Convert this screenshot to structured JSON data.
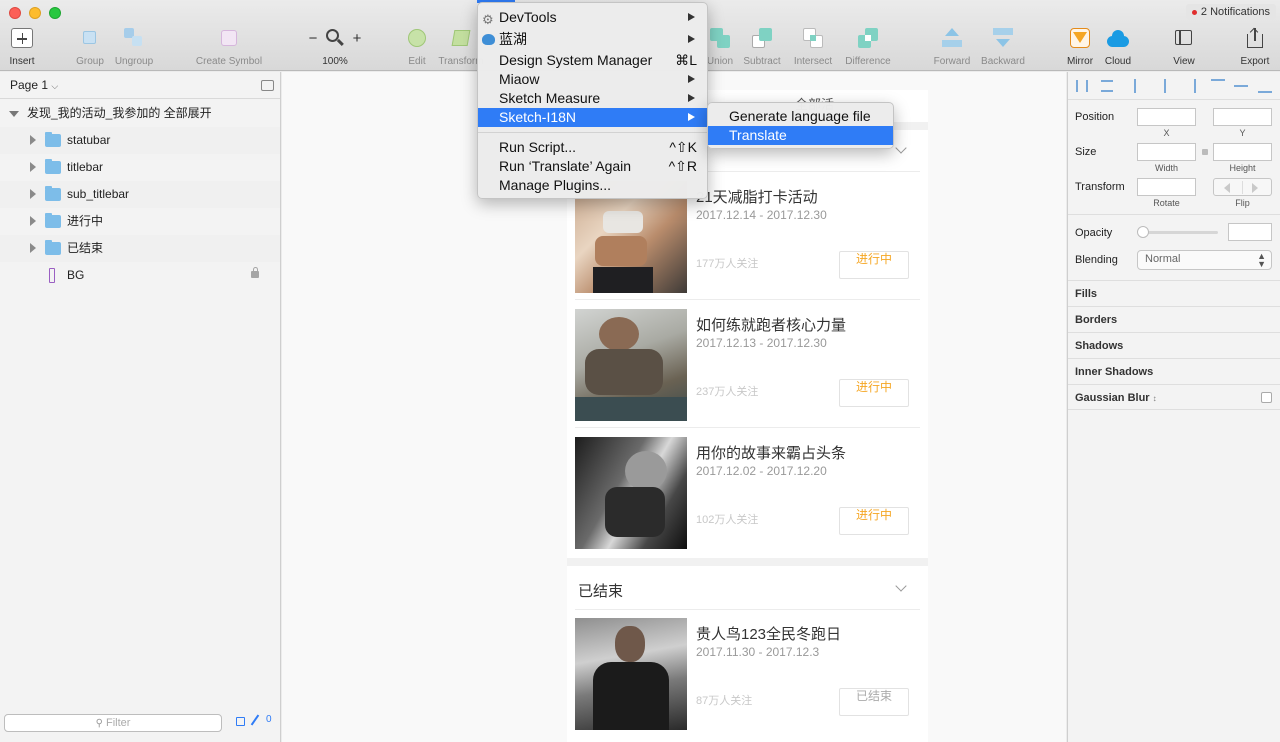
{
  "notifications": "2 Notifications",
  "toolbar": {
    "insert": "Insert",
    "group": "Group",
    "ungroup": "Ungroup",
    "create_symbol": "Create Symbol",
    "zoom_minus": "−",
    "zoom_plus": "+",
    "zoom": "100%",
    "edit": "Edit",
    "transform": "Transform",
    "union": "Union",
    "subtract": "Subtract",
    "intersect": "Intersect",
    "difference": "Difference",
    "forward": "Forward",
    "backward": "Backward",
    "mirror": "Mirror",
    "cloud": "Cloud",
    "view": "View",
    "export": "Export"
  },
  "layers": {
    "page": "Page 1",
    "artboard": "发现_我的活动_我参加的 全部展开",
    "items": [
      {
        "label": "statubar",
        "type": "folder"
      },
      {
        "label": "titlebar",
        "type": "folder"
      },
      {
        "label": "sub_titlebar",
        "type": "folder"
      },
      {
        "label": "进行中",
        "type": "folder"
      },
      {
        "label": "已结束",
        "type": "folder"
      },
      {
        "label": "BG",
        "type": "rect"
      }
    ],
    "filter_placeholder": "Filter",
    "filter_count": "0"
  },
  "plugins_menu": {
    "items": [
      {
        "label": "DevTools",
        "submenu": true
      },
      {
        "label": "蓝湖",
        "submenu": true
      },
      {
        "label": "Design System Manager",
        "shortcut": "⌘L"
      },
      {
        "label": "Miaow",
        "submenu": true
      },
      {
        "label": "Sketch Measure",
        "submenu": true
      },
      {
        "label": "Sketch-I18N",
        "submenu": true,
        "highlighted": true
      }
    ],
    "run_script": "Run Script...",
    "run_script_sc": "^⇧K",
    "run_again": "Run ‘Translate’ Again",
    "run_again_sc": "^⇧R",
    "manage": "Manage Plugins..."
  },
  "submenu": {
    "generate": "Generate language file",
    "translate": "Translate"
  },
  "artboard": {
    "top_tab_partial": "全部活",
    "ongoing_cards": [
      {
        "title": "21天减脂打卡活动",
        "date": "2017.12.14 - 2017.12.30",
        "followers": "177万人关注",
        "status": "进行中"
      },
      {
        "title": "如何练就跑者核心力量",
        "date": "2017.12.13 - 2017.12.30",
        "followers": "237万人关注",
        "status": "进行中"
      },
      {
        "title": "用你的故事来霸占头条",
        "date": "2017.12.02 - 2017.12.20",
        "followers": "102万人关注",
        "status": "进行中"
      }
    ],
    "ended_section": "已结束",
    "ended_cards": [
      {
        "title": "贵人鸟123全民冬跑日",
        "date": "2017.11.30 - 2017.12.3",
        "followers": "87万人关注",
        "status": "已结束"
      }
    ]
  },
  "inspector": {
    "position": "Position",
    "x": "X",
    "y": "Y",
    "size": "Size",
    "width": "Width",
    "height": "Height",
    "transform": "Transform",
    "rotate": "Rotate",
    "flip": "Flip",
    "opacity": "Opacity",
    "blending": "Blending",
    "blending_value": "Normal",
    "fills": "Fills",
    "borders": "Borders",
    "shadows": "Shadows",
    "inner_shadows": "Inner Shadows",
    "gaussian_blur": "Gaussian Blur"
  },
  "colors": {
    "accent": "#2f7cf6",
    "ongoing": "#f5a623",
    "ended": "#aaaaaa"
  }
}
